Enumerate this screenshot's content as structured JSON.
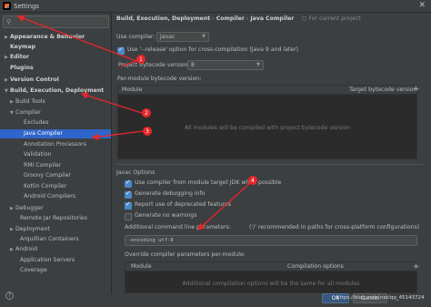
{
  "window": {
    "title": "Settings",
    "close_glyph": "✕"
  },
  "sidebar": {
    "search_placeholder": "",
    "items": [
      {
        "label": "Appearance & Behavior",
        "arrow": "▶",
        "bold": true
      },
      {
        "label": "Keymap",
        "arrow": "",
        "bold": true
      },
      {
        "label": "Editor",
        "arrow": "▶",
        "bold": true
      },
      {
        "label": "Plugins",
        "arrow": "",
        "bold": true
      },
      {
        "label": "Version Control",
        "arrow": "▶",
        "bold": true
      },
      {
        "label": "Build, Execution, Deployment",
        "arrow": "▼",
        "bold": true
      },
      {
        "label": "Build Tools",
        "arrow": "▶"
      },
      {
        "label": "Compiler",
        "arrow": "▼"
      },
      {
        "label": "Excludes",
        "arrow": ""
      },
      {
        "label": "Java Compiler",
        "arrow": "",
        "selected": true
      },
      {
        "label": "Annotation Processors",
        "arrow": ""
      },
      {
        "label": "Validation",
        "arrow": ""
      },
      {
        "label": "RMI Compiler",
        "arrow": ""
      },
      {
        "label": "Groovy Compiler",
        "arrow": ""
      },
      {
        "label": "Kotlin Compiler",
        "arrow": ""
      },
      {
        "label": "Android Compilers",
        "arrow": ""
      },
      {
        "label": "Debugger",
        "arrow": "▶"
      },
      {
        "label": "Remote Jar Repositories",
        "arrow": ""
      },
      {
        "label": "Deployment",
        "arrow": "▶"
      },
      {
        "label": "Arquillian Containers",
        "arrow": ""
      },
      {
        "label": "Android",
        "arrow": "▶"
      },
      {
        "label": "Application Servers",
        "arrow": ""
      },
      {
        "label": "Coverage",
        "arrow": ""
      }
    ],
    "help_glyph": "?"
  },
  "breadcrumb": {
    "parts": [
      "Build, Execution, Deployment",
      "Compiler",
      "Java Compiler"
    ],
    "separator": "›",
    "scope": "For current project"
  },
  "compiler": {
    "use_compiler_label": "Use compiler:",
    "use_compiler_value": "Javac",
    "release_option_label": "Use '--release' option for cross-compilation (Java 9 and later)",
    "release_option_checked": true,
    "bytecode_label": "Project bytecode version:",
    "bytecode_value": "8",
    "per_module_label": "Per-module bytecode version:",
    "module_table": {
      "columns": [
        "Module",
        "Target bytecode version"
      ],
      "empty_text": "All modules will be compiled with project bytecode version"
    }
  },
  "javac": {
    "section_title": "Javac Options",
    "options": [
      {
        "label": "Use compiler from module target JDK when possible",
        "checked": true
      },
      {
        "label": "Generate debugging info",
        "checked": true
      },
      {
        "label": "Report use of deprecated features",
        "checked": true
      },
      {
        "label": "Generate no warnings",
        "checked": false
      }
    ],
    "params_label": "Additional command line parameters:",
    "params_hint": "('/' recommended in paths for cross-platform configurations)",
    "params_value": "-encoding utf-8",
    "override_label": "Override compiler parameters per-module:",
    "override_table": {
      "columns": [
        "Module",
        "Compilation options"
      ],
      "empty_text": "Additional compilation options will be the same for all modules"
    }
  },
  "footer": {
    "ok": "OK",
    "cancel": "Cancel",
    "watermark": "https://blog.csdn.net/qq_45143724"
  },
  "annotations": {
    "color": "#e8262b",
    "badges": [
      "1",
      "2",
      "3",
      "4"
    ]
  }
}
